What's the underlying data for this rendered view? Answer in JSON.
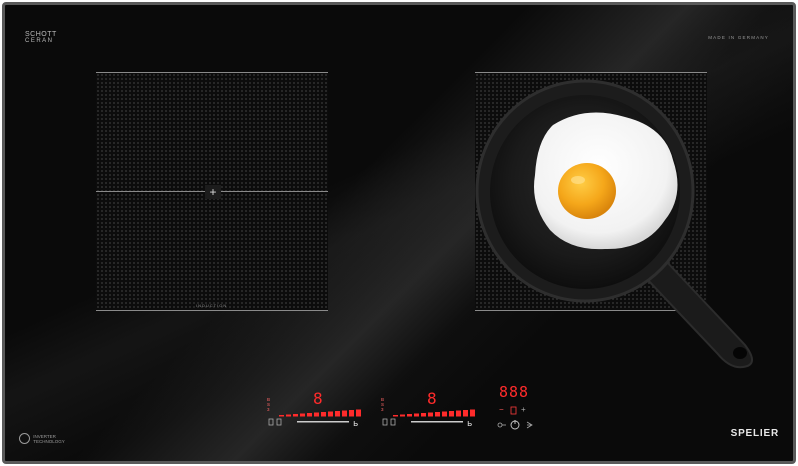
{
  "brand_top_left": {
    "line1": "SCHOTT",
    "line2": "CERAN"
  },
  "made_in": "MADE IN GERMANY",
  "zone_left": {
    "control_symbol": "+",
    "label": "INDUCTION"
  },
  "control_left": {
    "power_digit": "8",
    "side_labels": "B S 3",
    "bottom_marks": "IIII 3 :"
  },
  "control_right": {
    "power_digit": "8",
    "side_labels": "B S 3",
    "bottom_marks": "IIII 3 :"
  },
  "timer": {
    "display": "888",
    "minus": "−",
    "plus": "+"
  },
  "badge": {
    "line1": "INVERTER",
    "line2": "TECHNOLOGY"
  },
  "brand_bottom_right": "SPELIER",
  "colors": {
    "glass": "#0a0a0a",
    "frame": "#5a5a5a",
    "led_red": "#ff2b2b",
    "egg_yolk": "#f2a81c"
  },
  "image_subject": [
    "fried-egg",
    "cast-iron-pan",
    "induction-cooktop"
  ]
}
